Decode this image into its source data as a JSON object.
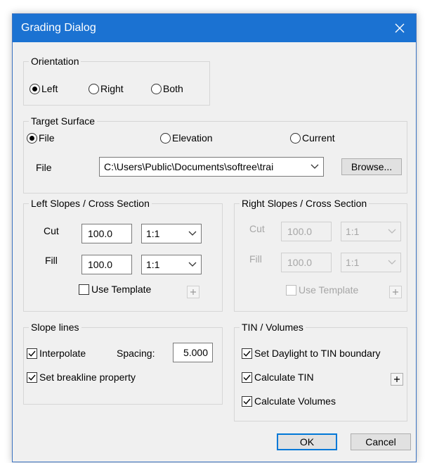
{
  "dialog": {
    "title": "Grading Dialog"
  },
  "orientation": {
    "legend": "Orientation",
    "options": [
      {
        "label": "Left",
        "selected": true
      },
      {
        "label": "Right",
        "selected": false
      },
      {
        "label": "Both",
        "selected": false
      }
    ]
  },
  "target_surface": {
    "legend": "Target Surface",
    "options": [
      {
        "label": "File",
        "selected": true
      },
      {
        "label": "Elevation",
        "selected": false
      },
      {
        "label": "Current",
        "selected": false
      }
    ],
    "file_label": "File",
    "file_value": "C:\\Users\\Public\\Documents\\softree\\trai",
    "browse_label": "Browse..."
  },
  "left_slopes": {
    "legend": "Left Slopes / Cross Section",
    "cut_label": "Cut",
    "cut_value": "100.0",
    "cut_ratio": "1:1",
    "fill_label": "Fill",
    "fill_value": "100.0",
    "fill_ratio": "1:1",
    "use_template_label": "Use Template",
    "use_template_checked": false,
    "enabled": true
  },
  "right_slopes": {
    "legend": "Right Slopes / Cross Section",
    "cut_label": "Cut",
    "cut_value": "100.0",
    "cut_ratio": "1:1",
    "fill_label": "Fill",
    "fill_value": "100.0",
    "fill_ratio": "1:1",
    "use_template_label": "Use Template",
    "use_template_checked": false,
    "enabled": false
  },
  "slope_lines": {
    "legend": "Slope lines",
    "interpolate_label": "Interpolate",
    "interpolate_checked": true,
    "spacing_label": "Spacing:",
    "spacing_value": "5.000",
    "breakline_label": "Set breakline property",
    "breakline_checked": true
  },
  "tin_volumes": {
    "legend": "TIN / Volumes",
    "daylight_label": "Set Daylight to TIN boundary",
    "daylight_checked": true,
    "calc_tin_label": "Calculate TIN",
    "calc_tin_checked": true,
    "calc_volumes_label": "Calculate Volumes",
    "calc_volumes_checked": true
  },
  "buttons": {
    "ok_label": "OK",
    "cancel_label": "Cancel"
  },
  "colors": {
    "titlebar": "#1b72d2",
    "accent": "#0078d7",
    "dialog_bg": "#f0f0f0"
  }
}
